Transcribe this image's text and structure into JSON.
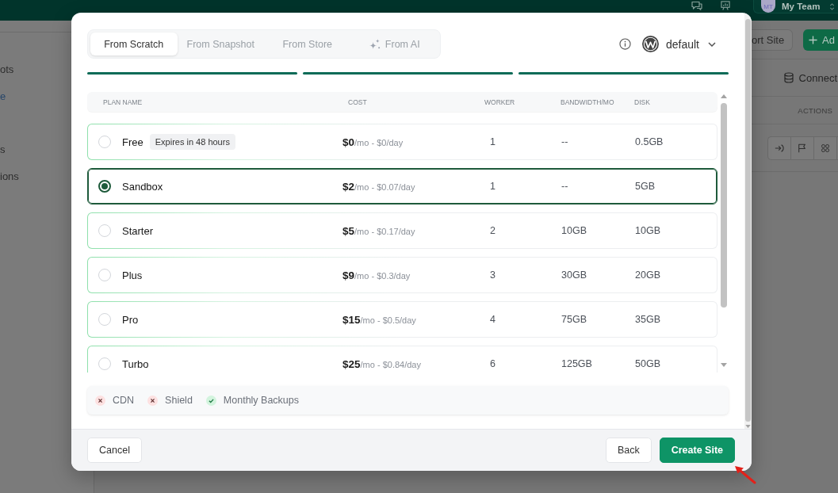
{
  "top_bar": {
    "avatar_initials": "MT",
    "team_name": "My Team"
  },
  "sidebar": {
    "items": [
      {
        "label": "ots",
        "selected": false
      },
      {
        "label": "e",
        "selected": true
      },
      {
        "label": "s",
        "selected": false
      },
      {
        "label": "ions",
        "selected": false
      }
    ]
  },
  "toolbar": {
    "buttons": [
      {
        "label": "ort Site",
        "kind": "secondary"
      },
      {
        "label": "Ad",
        "kind": "primary"
      }
    ]
  },
  "sites_table": {
    "connect_label": "Connect",
    "columns": [
      "ACTIONS"
    ]
  },
  "dialog": {
    "tabs": [
      {
        "label": "From Scratch",
        "selected": true,
        "kind": "plain"
      },
      {
        "label": "From Snapshot",
        "selected": false,
        "kind": "plain"
      },
      {
        "label": "From Store",
        "selected": false,
        "kind": "plain"
      },
      {
        "label": "From AI",
        "selected": false,
        "kind": "ai"
      }
    ],
    "template_select": {
      "value": "default"
    },
    "steps": [
      {
        "done": true
      },
      {
        "done": true
      },
      {
        "done": true
      }
    ],
    "plans": {
      "columns": [
        "PLAN NAME",
        "COST",
        "WORKER",
        "BANDWIDTH/MO",
        "DISK"
      ],
      "rows": [
        {
          "name": "Free",
          "badge": "Expires in 48 hours",
          "cost": "**$0**/mo - $0/day",
          "worker": "1",
          "bandwidth": "--",
          "disk": "0.5GB",
          "selected": false
        },
        {
          "name": "Sandbox",
          "cost": "**$2**/mo - $0.07/day",
          "worker": "1",
          "bandwidth": "--",
          "disk": "5GB",
          "selected": true
        },
        {
          "name": "Starter",
          "cost": "**$5**/mo - $0.17/day",
          "worker": "2",
          "bandwidth": "10GB",
          "disk": "10GB",
          "selected": false
        },
        {
          "name": "Plus",
          "cost": "**$9**/mo - $0.3/day",
          "worker": "3",
          "bandwidth": "30GB",
          "disk": "20GB",
          "selected": false
        },
        {
          "name": "Pro",
          "cost": "**$15**/mo - $0.5/day",
          "worker": "4",
          "bandwidth": "75GB",
          "disk": "35GB",
          "selected": false
        },
        {
          "name": "Turbo",
          "cost": "**$25**/mo - $0.84/day",
          "worker": "6",
          "bandwidth": "125GB",
          "disk": "50GB",
          "selected": false
        }
      ]
    },
    "features": [
      {
        "label": "CDN",
        "included": false
      },
      {
        "label": "Shield",
        "included": false
      },
      {
        "label": "Monthly Backups",
        "included": true
      }
    ],
    "buttons": [
      {
        "label": "Cancel",
        "kind": "cancel"
      },
      {
        "label": "Back",
        "kind": "back"
      },
      {
        "label": "Create Site",
        "kind": "primary"
      }
    ]
  }
}
